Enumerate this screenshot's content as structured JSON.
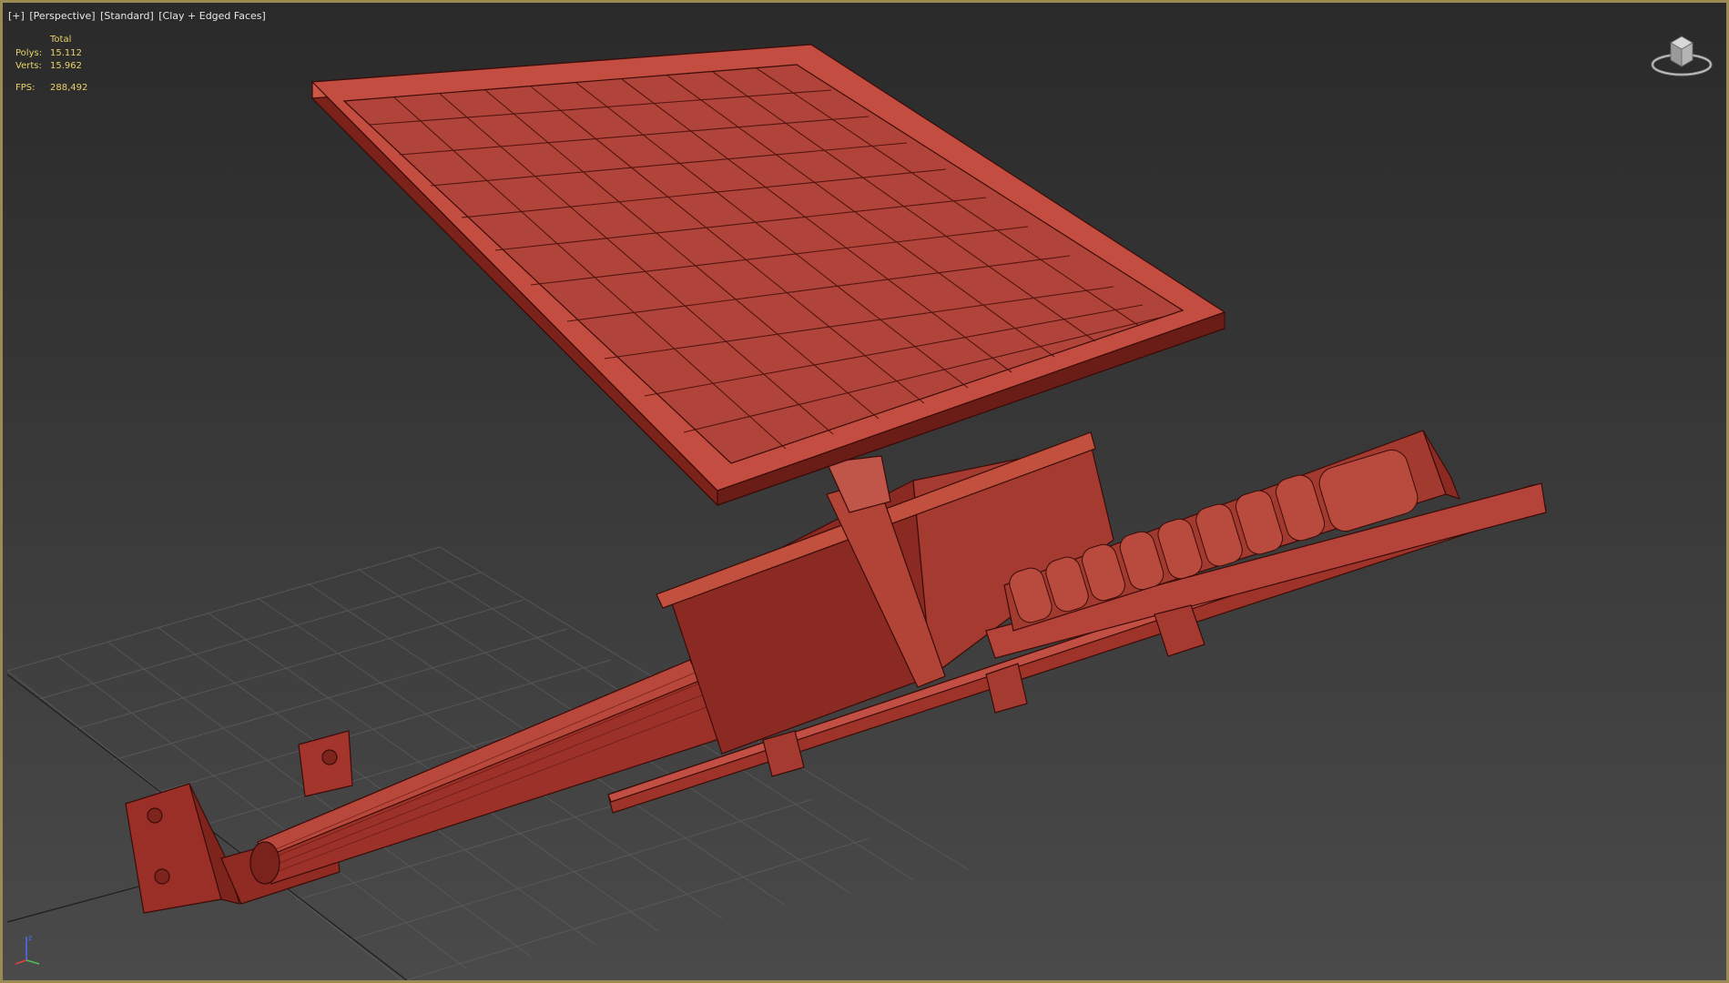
{
  "viewport": {
    "menu": "[+]",
    "view": "[Perspective]",
    "shading_mode": "[Standard]",
    "display_style": "[Clay + Edged Faces]"
  },
  "stats": {
    "header": "Total",
    "polys_label": "Polys:",
    "polys_value": "15.112",
    "verts_label": "Verts:",
    "verts_value": "15.962",
    "fps_label": "FPS:",
    "fps_value": "288,492"
  },
  "colors": {
    "viewport_border": "#9b8a52",
    "stats_text": "#e8d36a",
    "clay_model": "#b2443a",
    "grid": "#5a5a5a"
  },
  "icons": [
    "viewcube-icon",
    "axis-tripod-icon"
  ]
}
